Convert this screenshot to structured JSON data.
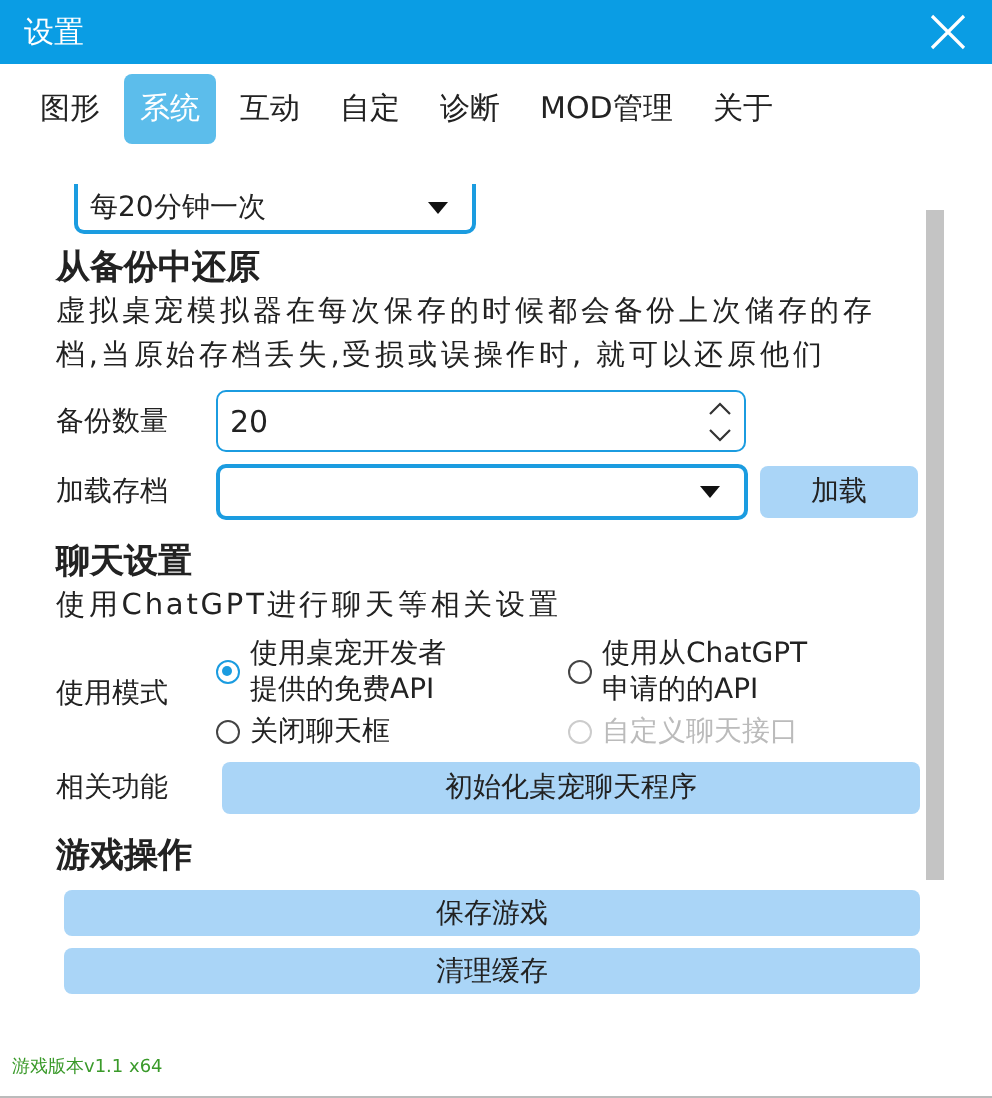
{
  "window": {
    "title": "设置"
  },
  "tabs": [
    {
      "label": "图形",
      "selected": false
    },
    {
      "label": "系统",
      "selected": true
    },
    {
      "label": "互动",
      "selected": false
    },
    {
      "label": "自定",
      "selected": false
    },
    {
      "label": "诊断",
      "selected": false
    },
    {
      "label": "MOD管理",
      "selected": false
    },
    {
      "label": "关于",
      "selected": false
    }
  ],
  "autosave_dropdown": {
    "value": "每20分钟一次"
  },
  "backup": {
    "heading": "从备份中还原",
    "description": "虚拟桌宠模拟器在每次保存的时候都会备份上次储存的存档,当原始存档丢失,受损或误操作时, 就可以还原他们",
    "count_label": "备份数量",
    "count_value": "20",
    "load_label": "加载存档",
    "load_button": "加载"
  },
  "chat": {
    "heading": "聊天设置",
    "description": "使用ChatGPT进行聊天等相关设置",
    "mode_label": "使用模式",
    "options": [
      {
        "label": "使用桌宠开发者提供的免费API",
        "selected": true,
        "disabled": false
      },
      {
        "label": "使用从ChatGPT申请的的API",
        "selected": false,
        "disabled": false
      },
      {
        "label": "关闭聊天框",
        "selected": false,
        "disabled": false
      },
      {
        "label": "自定义聊天接口",
        "selected": false,
        "disabled": true
      }
    ],
    "function_label": "相关功能",
    "function_button": "初始化桌宠聊天程序"
  },
  "game": {
    "heading": "游戏操作",
    "buttons": [
      "保存游戏",
      "清理缓存"
    ]
  },
  "version": "游戏版本v1.1 x64"
}
